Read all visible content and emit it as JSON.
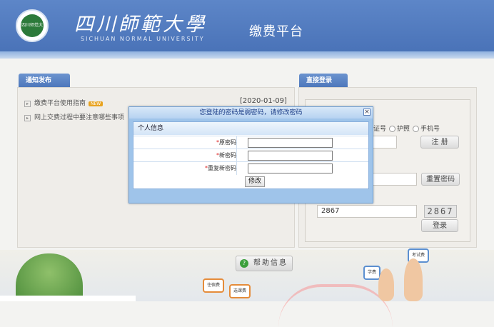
{
  "header": {
    "logo_text": "四川师范大学",
    "university_name_cn": "四川師範大學",
    "university_name_en": "SICHUAN NORMAL UNIVERSITY",
    "platform_title": "缴费平台"
  },
  "notice": {
    "tab_label": "通知发布",
    "items": [
      {
        "title": "缴费平台使用指南",
        "badge": "NEW",
        "date": "[2020-01-09]"
      },
      {
        "title": "网上交费过程中要注意哪些事项"
      }
    ]
  },
  "login": {
    "tab_label": "直接登录",
    "id_options": [
      "证号",
      "护照",
      "手机号"
    ],
    "register_button": "注 册",
    "reset_password_button": "重置密码",
    "captcha_input_value": "2867",
    "captcha_image_text": "2867",
    "login_button": "登录"
  },
  "dialog": {
    "title": "您登陆的密码是弱密码，请修改密码",
    "close_glyph": "×",
    "section_title": "个人信息",
    "fields": [
      {
        "label": "原密码",
        "value": ""
      },
      {
        "label": "新密码",
        "value": ""
      },
      {
        "label": "重复新密码",
        "value": ""
      }
    ],
    "required_mark": "*",
    "submit_label": "修改"
  },
  "bottom": {
    "help_button": "帮助信息",
    "bubbles": [
      "考试费",
      "学费",
      "住宿费",
      "选课费"
    ]
  },
  "colors": {
    "header_blue": "#4a73b8",
    "tab_blue": "#5a83c4",
    "dialog_blue": "#9fc4ea",
    "required_red": "#d22222"
  }
}
